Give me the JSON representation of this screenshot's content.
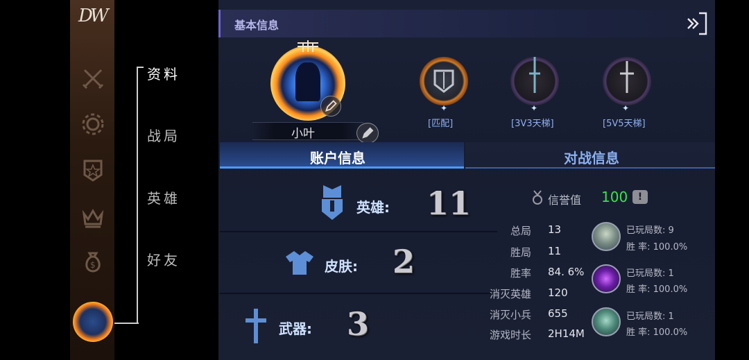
{
  "sidebar": {
    "logo": "DW",
    "icons": [
      "crossed-swords-icon",
      "gear-icon",
      "star-shield-icon",
      "crown-icon",
      "money-bag-icon"
    ]
  },
  "menu": {
    "items": [
      {
        "label": "资料",
        "active": true
      },
      {
        "label": "战局",
        "active": false
      },
      {
        "label": "英雄",
        "active": false
      },
      {
        "label": "好友",
        "active": false
      }
    ]
  },
  "panel": {
    "title": "基本信息",
    "player_name": "小叶",
    "ranks": [
      {
        "label": "[匹配]",
        "star": "✦"
      },
      {
        "label": "[3V3天梯]",
        "star": "✦"
      },
      {
        "label": "[5V5天梯]",
        "star": "✦"
      }
    ],
    "tabs": [
      {
        "label": "账户信息",
        "active": true
      },
      {
        "label": "对战信息",
        "active": false
      }
    ]
  },
  "account": {
    "stats": [
      {
        "label": "英雄:",
        "value": "11"
      },
      {
        "label": "皮肤:",
        "value": "2"
      },
      {
        "label": "武器:",
        "value": "3"
      }
    ],
    "honor": {
      "label": "信誉值",
      "value": "100",
      "info": "!"
    },
    "details": [
      {
        "label": "总局",
        "value": "13"
      },
      {
        "label": "胜局",
        "value": "11"
      },
      {
        "label": "胜率",
        "value": "84. 6%"
      },
      {
        "label": "消灭英雄",
        "value": "120"
      },
      {
        "label": "消灭小兵",
        "value": "655"
      },
      {
        "label": "游戏时长",
        "value": "2H14M"
      }
    ],
    "top_heroes": [
      {
        "played": "已玩局数: 9",
        "winrate": "胜   率:  100.0%"
      },
      {
        "played": "已玩局数: 1",
        "winrate": "胜   率:  100.0%"
      },
      {
        "played": "已玩局数: 1",
        "winrate": "胜   率:  100.0%"
      }
    ]
  }
}
